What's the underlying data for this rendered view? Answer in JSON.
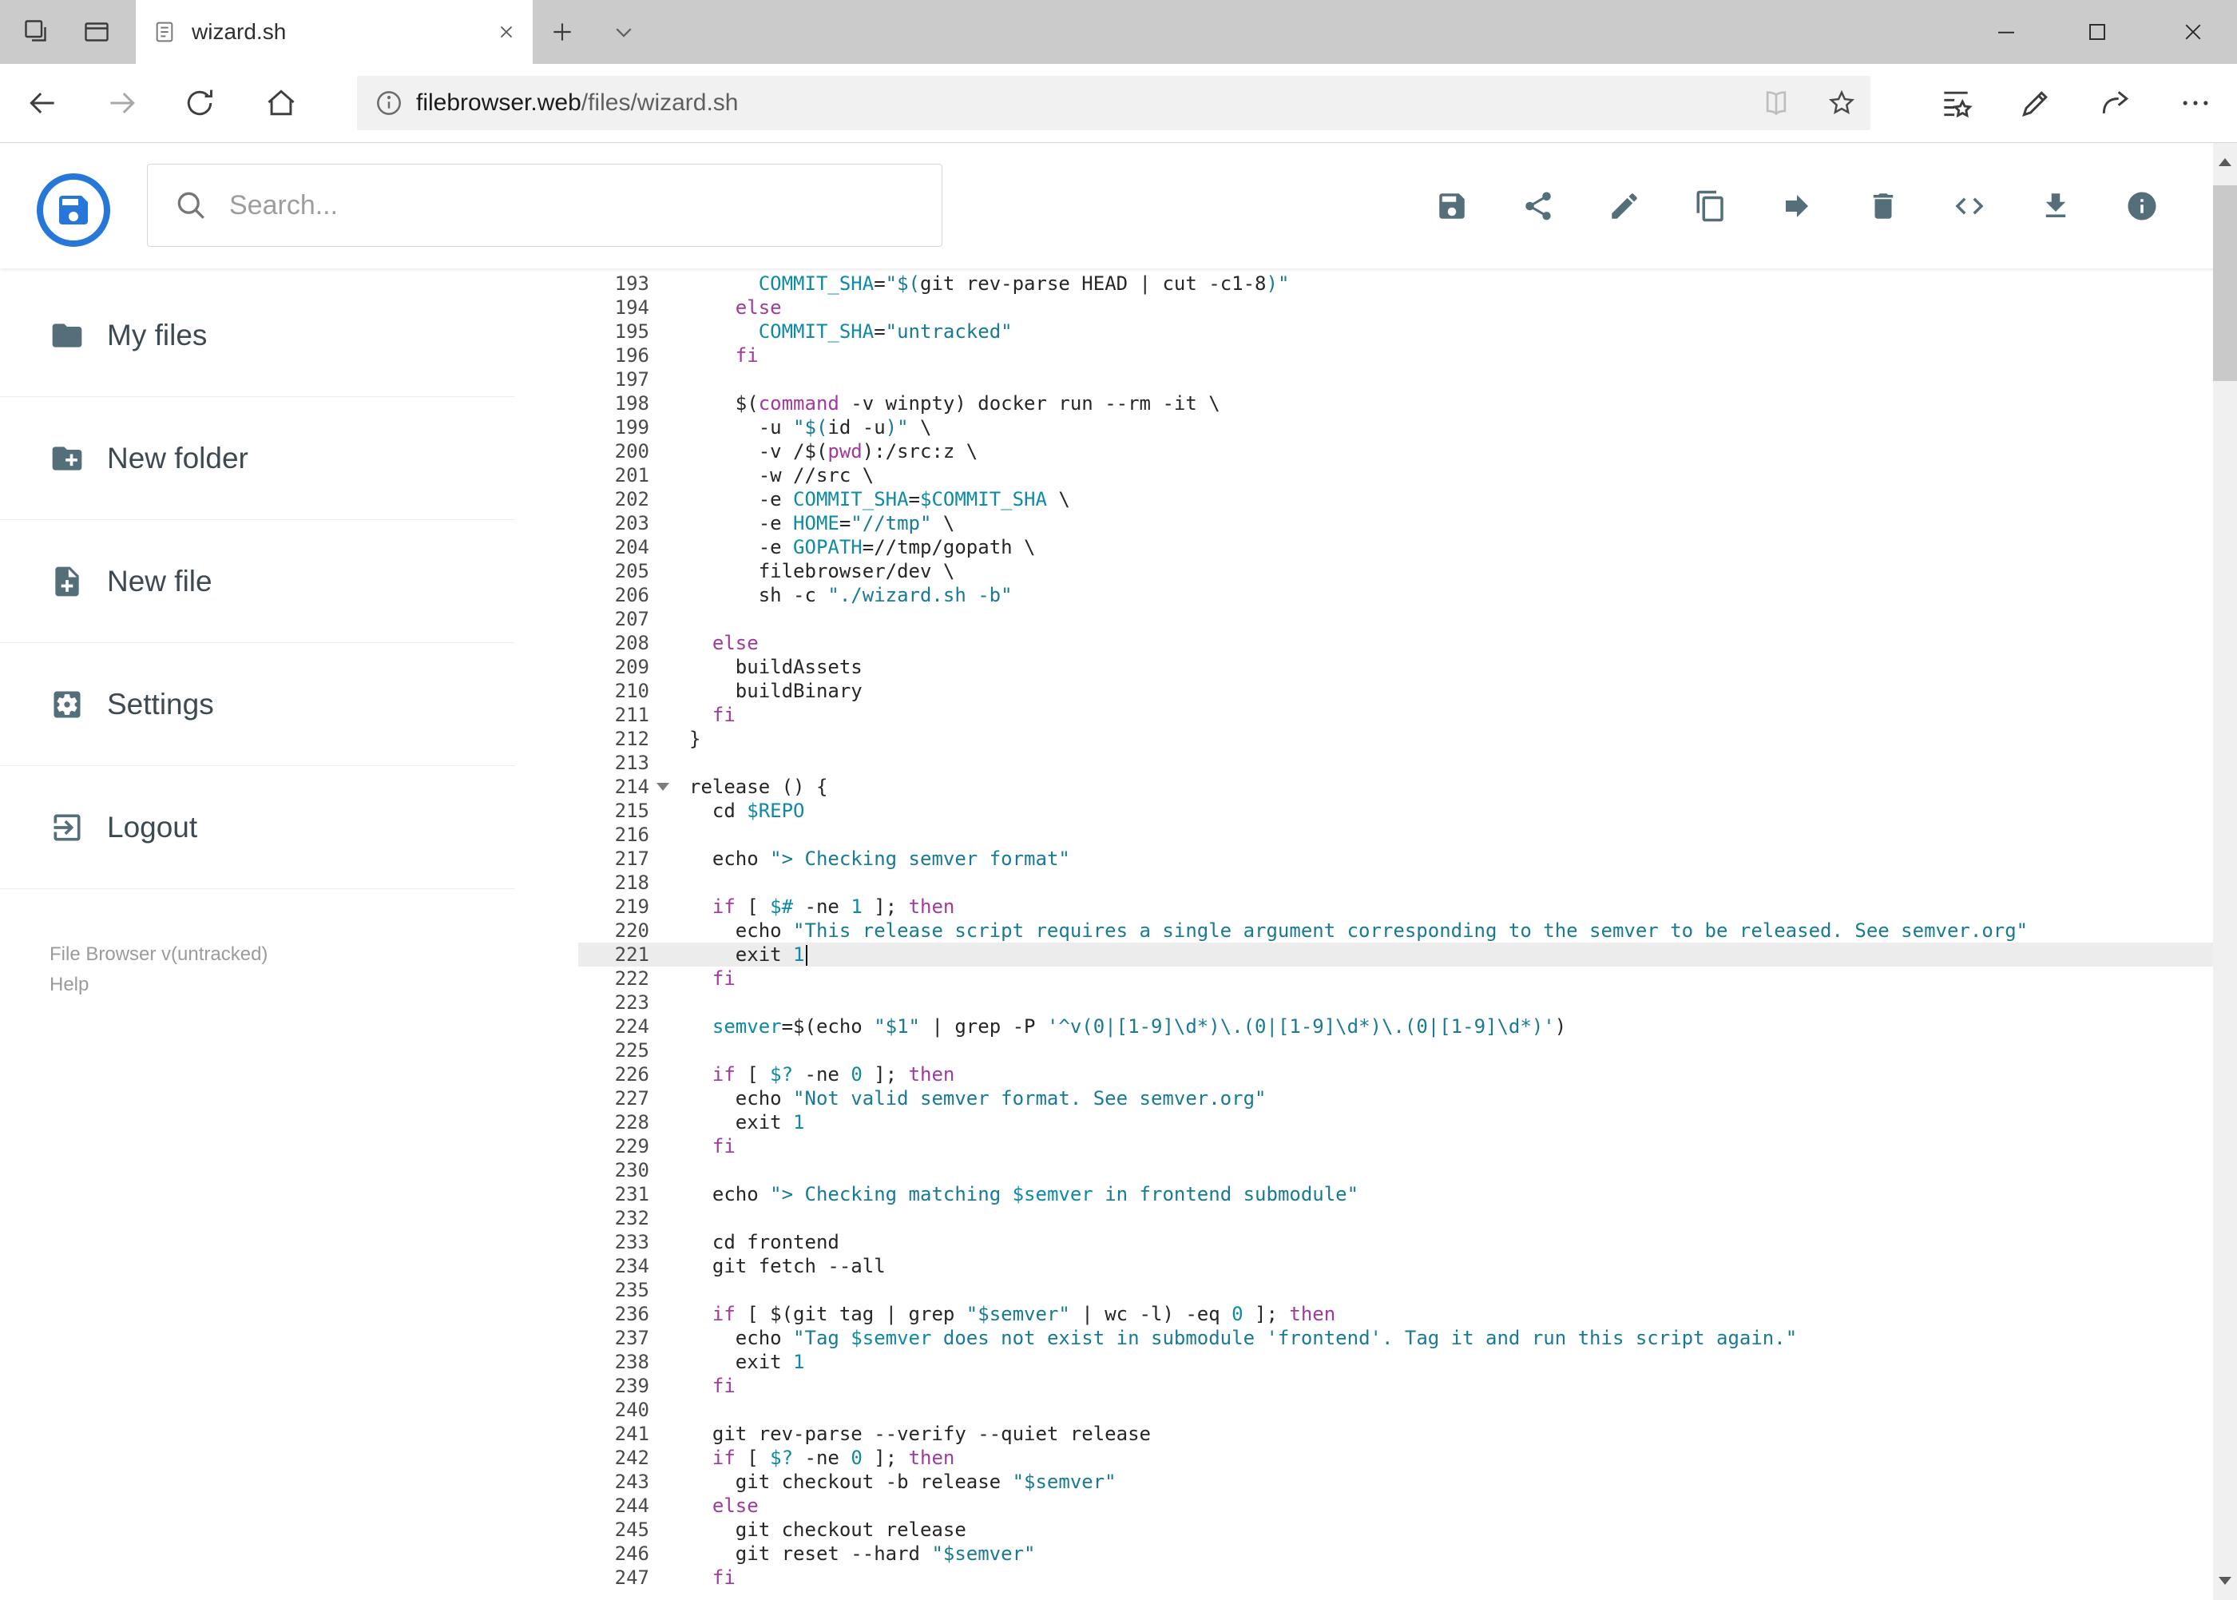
{
  "colors": {
    "accent_blue": "#2677d9",
    "header_icon_gray": "#546e7a",
    "tabbar_bg": "#cbcbcb",
    "active_line_bg": "#ececec",
    "syntax_keyword": "#a2399c",
    "syntax_string": "#187a95",
    "syntax_variable": "#0e8aa5",
    "syntax_default": "#262626"
  },
  "browser": {
    "tab_title": "wizard.sh",
    "url_domain": "filebrowser.web",
    "url_path": "/files/wizard.sh"
  },
  "app": {
    "search_placeholder": "Search...",
    "header_actions": [
      {
        "name": "save",
        "icon": "save"
      },
      {
        "name": "share",
        "icon": "share"
      },
      {
        "name": "rename",
        "icon": "pencil"
      },
      {
        "name": "copy",
        "icon": "copy"
      },
      {
        "name": "move",
        "icon": "move"
      },
      {
        "name": "delete",
        "icon": "delete"
      },
      {
        "name": "raw-code",
        "icon": "code"
      },
      {
        "name": "download",
        "icon": "download"
      },
      {
        "name": "info",
        "icon": "info"
      }
    ],
    "sidebar": {
      "items": [
        {
          "label": "My files",
          "icon": "folder"
        },
        {
          "label": "New folder",
          "icon": "folder-plus"
        },
        {
          "label": "New file",
          "icon": "file-plus"
        },
        {
          "label": "Settings",
          "icon": "settings"
        },
        {
          "label": "Logout",
          "icon": "logout"
        }
      ],
      "footer_version": "File Browser v(untracked)",
      "footer_help": "Help"
    },
    "editor": {
      "active_line": 221,
      "lines": [
        {
          "n": 193,
          "seg": [
            [
              "      ",
              "d"
            ],
            [
              "COMMIT_SHA",
              "v"
            ],
            [
              "=",
              "d"
            ],
            [
              "\"$(",
              "s"
            ],
            [
              "git rev-parse HEAD | cut -c1-8",
              "d"
            ],
            [
              ")\"",
              "s"
            ]
          ]
        },
        {
          "n": 194,
          "seg": [
            [
              "    ",
              "d"
            ],
            [
              "else",
              "k"
            ]
          ]
        },
        {
          "n": 195,
          "seg": [
            [
              "      ",
              "d"
            ],
            [
              "COMMIT_SHA",
              "v"
            ],
            [
              "=",
              "d"
            ],
            [
              "\"untracked\"",
              "s"
            ]
          ]
        },
        {
          "n": 196,
          "seg": [
            [
              "    ",
              "d"
            ],
            [
              "fi",
              "k"
            ]
          ]
        },
        {
          "n": 197,
          "seg": []
        },
        {
          "n": 198,
          "seg": [
            [
              "    $(",
              "d"
            ],
            [
              "command",
              "k"
            ],
            [
              " -v winpty) docker run --rm -it \\",
              "d"
            ]
          ]
        },
        {
          "n": 199,
          "seg": [
            [
              "      -u ",
              "d"
            ],
            [
              "\"$(",
              "s"
            ],
            [
              "id -u",
              "d"
            ],
            [
              ")\"",
              "s"
            ],
            [
              " \\",
              "d"
            ]
          ]
        },
        {
          "n": 200,
          "seg": [
            [
              "      -v /$(",
              "d"
            ],
            [
              "pwd",
              "k"
            ],
            [
              "):/src:z \\",
              "d"
            ]
          ]
        },
        {
          "n": 201,
          "seg": [
            [
              "      -w //src \\",
              "d"
            ]
          ]
        },
        {
          "n": 202,
          "seg": [
            [
              "      -e ",
              "d"
            ],
            [
              "COMMIT_SHA",
              "v"
            ],
            [
              "=",
              "d"
            ],
            [
              "$COMMIT_SHA",
              "v"
            ],
            [
              " \\",
              "d"
            ]
          ]
        },
        {
          "n": 203,
          "seg": [
            [
              "      -e ",
              "d"
            ],
            [
              "HOME",
              "v"
            ],
            [
              "=",
              "d"
            ],
            [
              "\"//tmp\"",
              "s"
            ],
            [
              " \\",
              "d"
            ]
          ]
        },
        {
          "n": 204,
          "seg": [
            [
              "      -e ",
              "d"
            ],
            [
              "GOPATH",
              "v"
            ],
            [
              "=",
              "d"
            ],
            [
              "//tmp/gopath \\",
              "d"
            ]
          ]
        },
        {
          "n": 205,
          "seg": [
            [
              "      filebrowser/dev \\",
              "d"
            ]
          ]
        },
        {
          "n": 206,
          "seg": [
            [
              "      sh -c ",
              "d"
            ],
            [
              "\"./wizard.sh -b\"",
              "s"
            ]
          ]
        },
        {
          "n": 207,
          "seg": []
        },
        {
          "n": 208,
          "seg": [
            [
              "  ",
              "d"
            ],
            [
              "else",
              "k"
            ]
          ]
        },
        {
          "n": 209,
          "seg": [
            [
              "    buildAssets",
              "d"
            ]
          ]
        },
        {
          "n": 210,
          "seg": [
            [
              "    buildBinary",
              "d"
            ]
          ]
        },
        {
          "n": 211,
          "seg": [
            [
              "  ",
              "d"
            ],
            [
              "fi",
              "k"
            ]
          ]
        },
        {
          "n": 212,
          "seg": [
            [
              "}",
              "d"
            ]
          ]
        },
        {
          "n": 213,
          "seg": []
        },
        {
          "n": 214,
          "fold": true,
          "seg": [
            [
              "release () {",
              "d"
            ]
          ]
        },
        {
          "n": 215,
          "seg": [
            [
              "  cd ",
              "d"
            ],
            [
              "$REPO",
              "v"
            ]
          ]
        },
        {
          "n": 216,
          "seg": []
        },
        {
          "n": 217,
          "seg": [
            [
              "  echo ",
              "d"
            ],
            [
              "\"> Checking semver format\"",
              "s"
            ]
          ]
        },
        {
          "n": 218,
          "seg": []
        },
        {
          "n": 219,
          "seg": [
            [
              "  ",
              "d"
            ],
            [
              "if",
              "k"
            ],
            [
              " [ ",
              "d"
            ],
            [
              "$#",
              "v"
            ],
            [
              " -ne ",
              "d"
            ],
            [
              "1",
              "n"
            ],
            [
              " ]; ",
              "d"
            ],
            [
              "then",
              "k"
            ]
          ]
        },
        {
          "n": 220,
          "seg": [
            [
              "    echo ",
              "d"
            ],
            [
              "\"This release script requires a single argument corresponding to the semver to be released. See semver.org\"",
              "s"
            ]
          ]
        },
        {
          "n": 221,
          "active": true,
          "cursor": true,
          "seg": [
            [
              "    exit ",
              "d"
            ],
            [
              "1",
              "n"
            ]
          ]
        },
        {
          "n": 222,
          "seg": [
            [
              "  ",
              "d"
            ],
            [
              "fi",
              "k"
            ]
          ]
        },
        {
          "n": 223,
          "seg": []
        },
        {
          "n": 224,
          "seg": [
            [
              "  ",
              "d"
            ],
            [
              "semver",
              "v"
            ],
            [
              "=$(echo ",
              "d"
            ],
            [
              "\"$1\"",
              "s"
            ],
            [
              " | grep -P ",
              "d"
            ],
            [
              "'^v(0|[1-9]\\d*)\\.(0|[1-9]\\d*)\\.(0|[1-9]\\d*)'",
              "s"
            ],
            [
              ")",
              "d"
            ]
          ]
        },
        {
          "n": 225,
          "seg": []
        },
        {
          "n": 226,
          "seg": [
            [
              "  ",
              "d"
            ],
            [
              "if",
              "k"
            ],
            [
              " [ ",
              "d"
            ],
            [
              "$?",
              "v"
            ],
            [
              " -ne ",
              "d"
            ],
            [
              "0",
              "n"
            ],
            [
              " ]; ",
              "d"
            ],
            [
              "then",
              "k"
            ]
          ]
        },
        {
          "n": 227,
          "seg": [
            [
              "    echo ",
              "d"
            ],
            [
              "\"Not valid semver format. See semver.org\"",
              "s"
            ]
          ]
        },
        {
          "n": 228,
          "seg": [
            [
              "    exit ",
              "d"
            ],
            [
              "1",
              "n"
            ]
          ]
        },
        {
          "n": 229,
          "seg": [
            [
              "  ",
              "d"
            ],
            [
              "fi",
              "k"
            ]
          ]
        },
        {
          "n": 230,
          "seg": []
        },
        {
          "n": 231,
          "seg": [
            [
              "  echo ",
              "d"
            ],
            [
              "\"> Checking matching ",
              "s"
            ],
            [
              "$semver",
              "v"
            ],
            [
              " in frontend submodule\"",
              "s"
            ]
          ]
        },
        {
          "n": 232,
          "seg": []
        },
        {
          "n": 233,
          "seg": [
            [
              "  cd frontend",
              "d"
            ]
          ]
        },
        {
          "n": 234,
          "seg": [
            [
              "  git fetch --all",
              "d"
            ]
          ]
        },
        {
          "n": 235,
          "seg": []
        },
        {
          "n": 236,
          "seg": [
            [
              "  ",
              "d"
            ],
            [
              "if",
              "k"
            ],
            [
              " [ $(git tag | grep ",
              "d"
            ],
            [
              "\"$semver\"",
              "s"
            ],
            [
              " | wc -l) -eq ",
              "d"
            ],
            [
              "0",
              "n"
            ],
            [
              " ]; ",
              "d"
            ],
            [
              "then",
              "k"
            ]
          ]
        },
        {
          "n": 237,
          "seg": [
            [
              "    echo ",
              "d"
            ],
            [
              "\"Tag ",
              "s"
            ],
            [
              "$semver",
              "v"
            ],
            [
              " does not exist in submodule 'frontend'. Tag it and run this script again.\"",
              "s"
            ]
          ]
        },
        {
          "n": 238,
          "seg": [
            [
              "    exit ",
              "d"
            ],
            [
              "1",
              "n"
            ]
          ]
        },
        {
          "n": 239,
          "seg": [
            [
              "  ",
              "d"
            ],
            [
              "fi",
              "k"
            ]
          ]
        },
        {
          "n": 240,
          "seg": []
        },
        {
          "n": 241,
          "seg": [
            [
              "  git rev-parse --verify --quiet release",
              "d"
            ]
          ]
        },
        {
          "n": 242,
          "seg": [
            [
              "  ",
              "d"
            ],
            [
              "if",
              "k"
            ],
            [
              " [ ",
              "d"
            ],
            [
              "$?",
              "v"
            ],
            [
              " -ne ",
              "d"
            ],
            [
              "0",
              "n"
            ],
            [
              " ]; ",
              "d"
            ],
            [
              "then",
              "k"
            ]
          ]
        },
        {
          "n": 243,
          "seg": [
            [
              "    git checkout -b release ",
              "d"
            ],
            [
              "\"$semver\"",
              "s"
            ]
          ]
        },
        {
          "n": 244,
          "seg": [
            [
              "  ",
              "d"
            ],
            [
              "else",
              "k"
            ]
          ]
        },
        {
          "n": 245,
          "seg": [
            [
              "    git checkout release",
              "d"
            ]
          ]
        },
        {
          "n": 246,
          "seg": [
            [
              "    git reset --hard ",
              "d"
            ],
            [
              "\"$semver\"",
              "s"
            ]
          ]
        },
        {
          "n": 247,
          "seg": [
            [
              "  ",
              "d"
            ],
            [
              "fi",
              "k"
            ]
          ]
        }
      ]
    }
  }
}
